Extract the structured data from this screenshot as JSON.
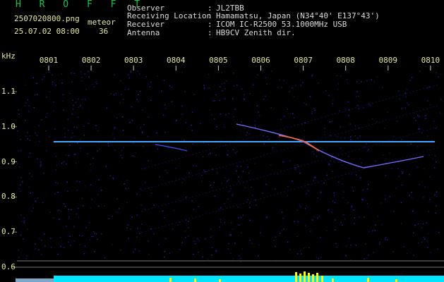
{
  "header": {
    "brand": "H R O F F T",
    "file_name": "2507020800.png",
    "date_time": "25.07.02 08:00",
    "meteor_label": "meteor",
    "meteor_count": "36"
  },
  "station_info": [
    {
      "label": "Observer",
      "value": "JL2TBB"
    },
    {
      "label": "Receiving Location",
      "value": "Hamamatsu, Japan (N34°40' E137°43')"
    },
    {
      "label": "Receiver",
      "value": "ICOM IC-R2500 53.1000MHz USB"
    },
    {
      "label": "Antenna",
      "value": "HB9CV Zenith dir."
    }
  ],
  "separator": ":",
  "spectrogram": {
    "unit_label": "kHz",
    "time_ticks": [
      "0801",
      "0802",
      "0803",
      "0804",
      "0805",
      "0806",
      "0807",
      "0808",
      "0809",
      "0810"
    ],
    "freq_ticks": [
      "1.1",
      "1.0",
      "0.9",
      "0.8",
      "0.7",
      "0.6"
    ],
    "colors": {
      "background": "#000000",
      "tick_text": "#e6e6a0",
      "header_green": "#19c24a",
      "carrier": "#3fa8ff",
      "noise": "#2a2ad8",
      "level_cyan": "#00e5ff",
      "level_yellow": "#ffff00"
    }
  }
}
